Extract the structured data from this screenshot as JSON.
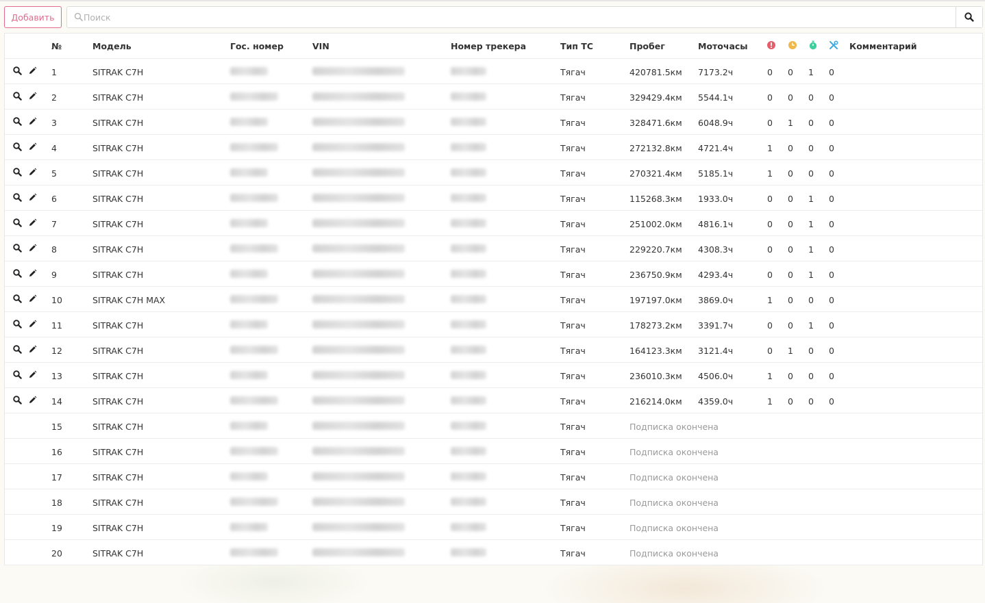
{
  "toolbar": {
    "add_label": "Добавить",
    "search_placeholder": "Поиск",
    "search_value": ""
  },
  "table": {
    "headers": {
      "num": "№",
      "model": "Модель",
      "plate": "Гос. номер",
      "vin": "VIN",
      "tracker": "Номер трекера",
      "type": "Тип ТС",
      "mileage": "Пробег",
      "hours": "Моточасы",
      "comment": "Комментарий"
    },
    "header_icons": [
      {
        "name": "alert-icon",
        "color": "#e45f6b"
      },
      {
        "name": "clock-icon",
        "color": "#f0b84a"
      },
      {
        "name": "timer-icon",
        "color": "#3fcf9f"
      },
      {
        "name": "tools-icon",
        "color": "#3fa9e0"
      }
    ],
    "rows": [
      {
        "num": "1",
        "model": "SITRAK C7H",
        "type": "Тягач",
        "mileage": "420781.5км",
        "hours": "7173.2ч",
        "c1": "0",
        "c2": "0",
        "c3": "1",
        "c4": "0",
        "active": true
      },
      {
        "num": "2",
        "model": "SITRAK C7H",
        "type": "Тягач",
        "mileage": "329429.4км",
        "hours": "5544.1ч",
        "c1": "0",
        "c2": "0",
        "c3": "0",
        "c4": "0",
        "active": true
      },
      {
        "num": "3",
        "model": "SITRAK C7H",
        "type": "Тягач",
        "mileage": "328471.6км",
        "hours": "6048.9ч",
        "c1": "0",
        "c2": "1",
        "c3": "0",
        "c4": "0",
        "active": true
      },
      {
        "num": "4",
        "model": "SITRAK C7H",
        "type": "Тягач",
        "mileage": "272132.8км",
        "hours": "4721.4ч",
        "c1": "1",
        "c2": "0",
        "c3": "0",
        "c4": "0",
        "active": true
      },
      {
        "num": "5",
        "model": "SITRAK C7H",
        "type": "Тягач",
        "mileage": "270321.4км",
        "hours": "5185.1ч",
        "c1": "1",
        "c2": "0",
        "c3": "0",
        "c4": "0",
        "active": true
      },
      {
        "num": "6",
        "model": "SITRAK C7H",
        "type": "Тягач",
        "mileage": "115268.3км",
        "hours": "1933.0ч",
        "c1": "0",
        "c2": "0",
        "c3": "1",
        "c4": "0",
        "active": true
      },
      {
        "num": "7",
        "model": "SITRAK C7H",
        "type": "Тягач",
        "mileage": "251002.0км",
        "hours": "4816.1ч",
        "c1": "0",
        "c2": "0",
        "c3": "1",
        "c4": "0",
        "active": true
      },
      {
        "num": "8",
        "model": "SITRAK C7H",
        "type": "Тягач",
        "mileage": "229220.7км",
        "hours": "4308.3ч",
        "c1": "0",
        "c2": "0",
        "c3": "1",
        "c4": "0",
        "active": true
      },
      {
        "num": "9",
        "model": "SITRAK C7H",
        "type": "Тягач",
        "mileage": "236750.9км",
        "hours": "4293.4ч",
        "c1": "0",
        "c2": "0",
        "c3": "1",
        "c4": "0",
        "active": true
      },
      {
        "num": "10",
        "model": "SITRAK C7H MAX",
        "type": "Тягач",
        "mileage": "197197.0км",
        "hours": "3869.0ч",
        "c1": "1",
        "c2": "0",
        "c3": "0",
        "c4": "0",
        "active": true
      },
      {
        "num": "11",
        "model": "SITRAK C7H",
        "type": "Тягач",
        "mileage": "178273.2км",
        "hours": "3391.7ч",
        "c1": "0",
        "c2": "0",
        "c3": "1",
        "c4": "0",
        "active": true
      },
      {
        "num": "12",
        "model": "SITRAK C7H",
        "type": "Тягач",
        "mileage": "164123.3км",
        "hours": "3121.4ч",
        "c1": "0",
        "c2": "1",
        "c3": "0",
        "c4": "0",
        "active": true
      },
      {
        "num": "13",
        "model": "SITRAK C7H",
        "type": "Тягач",
        "mileage": "236010.3км",
        "hours": "4506.0ч",
        "c1": "1",
        "c2": "0",
        "c3": "0",
        "c4": "0",
        "active": true
      },
      {
        "num": "14",
        "model": "SITRAK C7H",
        "type": "Тягач",
        "mileage": "216214.0км",
        "hours": "4359.0ч",
        "c1": "1",
        "c2": "0",
        "c3": "0",
        "c4": "0",
        "active": true
      },
      {
        "num": "15",
        "model": "SITRAK C7H",
        "type": "Тягач",
        "status": "Подписка окончена",
        "active": false
      },
      {
        "num": "16",
        "model": "SITRAK C7H",
        "type": "Тягач",
        "status": "Подписка окончена",
        "active": false
      },
      {
        "num": "17",
        "model": "SITRAK C7H",
        "type": "Тягач",
        "status": "Подписка окончена",
        "active": false
      },
      {
        "num": "18",
        "model": "SITRAK C7H",
        "type": "Тягач",
        "status": "Подписка окончена",
        "active": false
      },
      {
        "num": "19",
        "model": "SITRAK C7H",
        "type": "Тягач",
        "status": "Подписка окончена",
        "active": false
      },
      {
        "num": "20",
        "model": "SITRAK C7H",
        "type": "Тягач",
        "status": "Подписка окончена",
        "active": false
      }
    ]
  }
}
